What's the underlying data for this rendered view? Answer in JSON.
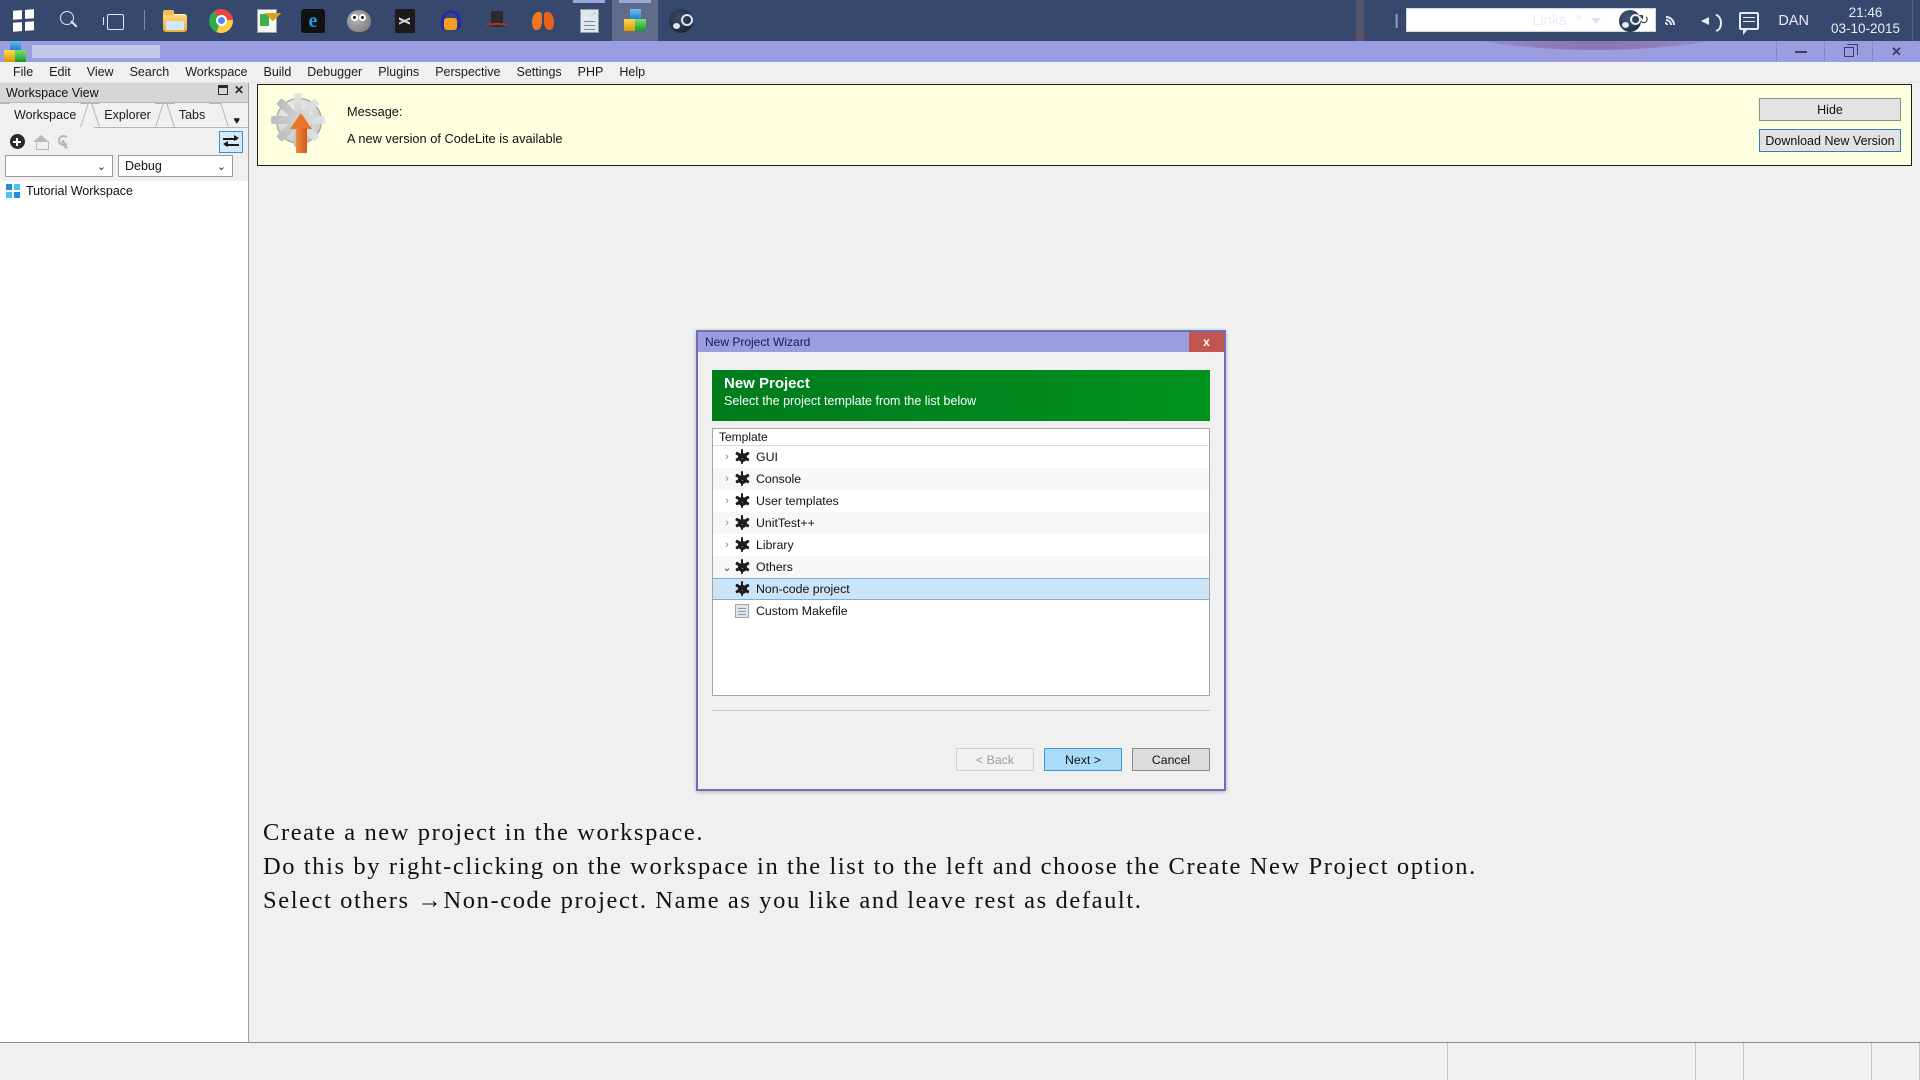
{
  "taskbar": {
    "items": [
      {
        "name": "start-button",
        "icon": "windows-logo-icon"
      },
      {
        "name": "search-icon",
        "icon": "search-icon"
      },
      {
        "name": "task-view-icon",
        "icon": "task-view-icon"
      },
      {
        "name": "file-explorer",
        "icon": "folder-icon"
      },
      {
        "name": "google-chrome",
        "icon": "chrome-icon"
      },
      {
        "name": "notepad-plus-plus",
        "icon": "notepad-icon"
      },
      {
        "name": "internet-explorer",
        "icon": "edge-icon"
      },
      {
        "name": "gimp",
        "icon": "gimp-icon"
      },
      {
        "name": "inkscape",
        "icon": "inkscape-icon"
      },
      {
        "name": "audacity",
        "icon": "headphones-icon"
      },
      {
        "name": "tophat-app",
        "icon": "tophat-icon"
      },
      {
        "name": "butterfly-app",
        "icon": "butterfly-icon"
      },
      {
        "name": "document-app",
        "icon": "document-icon"
      },
      {
        "name": "codelite",
        "icon": "codelite-cubes-icon"
      },
      {
        "name": "steam",
        "icon": "steam-icon"
      }
    ],
    "tray": {
      "links_label": "Links",
      "overflow_glyph": "»",
      "user": "DAN",
      "time": "21:46",
      "date": "03-10-2015"
    }
  },
  "app": {
    "title": "",
    "menu": [
      "File",
      "Edit",
      "View",
      "Search",
      "Workspace",
      "Build",
      "Debugger",
      "Plugins",
      "Perspective",
      "Settings",
      "PHP",
      "Help"
    ]
  },
  "sidebar": {
    "caption": "Workspace View",
    "tabs": [
      {
        "label": "Workspace",
        "selected": true
      },
      {
        "label": "Explorer",
        "selected": false
      },
      {
        "label": "Tabs",
        "selected": false
      }
    ],
    "tabs_more_glyph": "♥",
    "config_select_value": "",
    "build_select_value": "Debug",
    "select_caret": "⌄",
    "tree": [
      {
        "label": "Tutorial Workspace",
        "icon": "workspace-icon"
      }
    ]
  },
  "notification": {
    "label": "Message:",
    "message": "A new version of CodeLite is available",
    "hide_button": "Hide",
    "download_button": "Download New Version"
  },
  "dialog": {
    "titlebar": "New Project Wizard",
    "close_glyph": "x",
    "banner_title": "New Project",
    "banner_subtitle": "Select the project template from the list below",
    "list_header": "Template",
    "rows": [
      {
        "label": "GUI",
        "twisty": "›",
        "expanded": false,
        "icon": "gear-icon",
        "indent": 0,
        "selected": false
      },
      {
        "label": "Console",
        "twisty": "›",
        "expanded": false,
        "icon": "gear-icon",
        "indent": 0,
        "selected": false
      },
      {
        "label": "User templates",
        "twisty": "›",
        "expanded": false,
        "icon": "gear-icon",
        "indent": 0,
        "selected": false
      },
      {
        "label": "UnitTest++",
        "twisty": "›",
        "expanded": false,
        "icon": "gear-icon",
        "indent": 0,
        "selected": false
      },
      {
        "label": "Library",
        "twisty": "›",
        "expanded": false,
        "icon": "gear-icon",
        "indent": 0,
        "selected": false
      },
      {
        "label": "Others",
        "twisty": "⌄",
        "expanded": true,
        "icon": "gear-icon",
        "indent": 0,
        "selected": false
      },
      {
        "label": "Non-code project",
        "twisty": "",
        "expanded": false,
        "icon": "gear-icon",
        "indent": 1,
        "selected": true
      },
      {
        "label": "Custom Makefile",
        "twisty": "",
        "expanded": false,
        "icon": "makefile-icon",
        "indent": 1,
        "selected": false
      }
    ],
    "buttons": {
      "back": "< Back",
      "next": "Next >",
      "cancel": "Cancel"
    }
  },
  "annotation": {
    "line1": "Create a new project in the workspace.",
    "line2": "Do this by right-clicking on the workspace in the list to the left and choose the Create New Project option.",
    "line3": "Select others →Non-code project. Name as you like and leave rest as default."
  },
  "colors": {
    "taskbar_bg": "#37486e",
    "titlebar": "#9a9ddf",
    "banner_green": "#007c1c",
    "notification_bg": "#feffdf",
    "selection_blue": "#cce4f7",
    "close_red": "#c0564f"
  }
}
